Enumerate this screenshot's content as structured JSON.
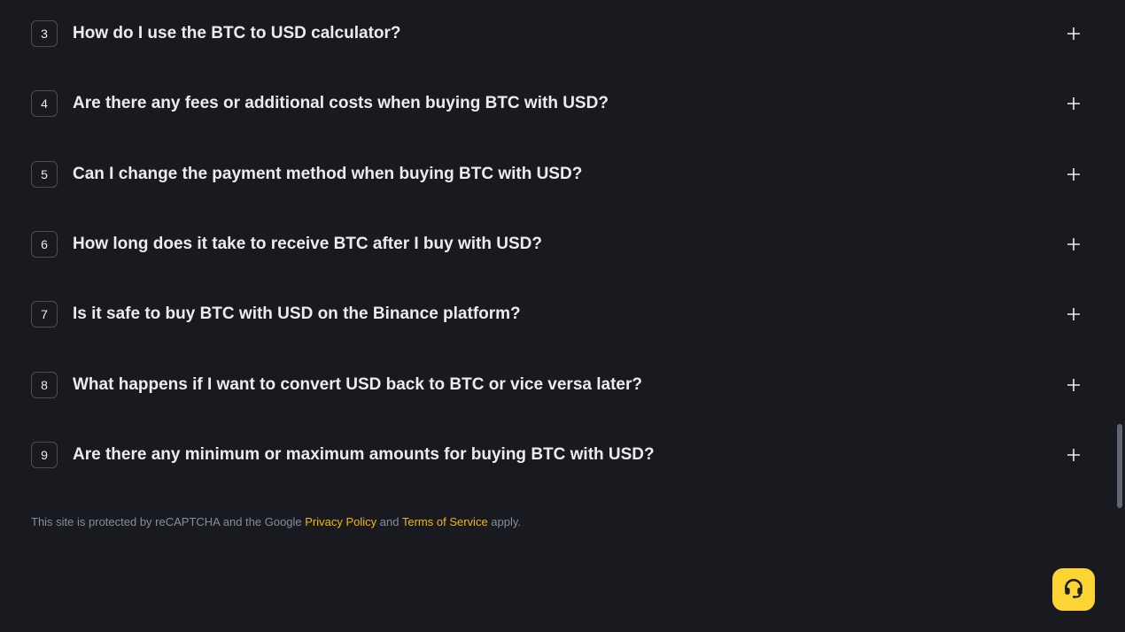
{
  "faq": {
    "items": [
      {
        "number": "3",
        "question": "How do I use the BTC to USD calculator?"
      },
      {
        "number": "4",
        "question": "Are there any fees or additional costs when buying BTC with USD?"
      },
      {
        "number": "5",
        "question": "Can I change the payment method when buying BTC with USD?"
      },
      {
        "number": "6",
        "question": "How long does it take to receive BTC after I buy with USD?"
      },
      {
        "number": "7",
        "question": "Is it safe to buy BTC with USD on the Binance platform?"
      },
      {
        "number": "8",
        "question": "What happens if I want to convert USD back to BTC or vice versa later?"
      },
      {
        "number": "9",
        "question": "Are there any minimum or maximum amounts for buying BTC with USD?"
      }
    ],
    "toggle_icon": "plus-icon"
  },
  "footer": {
    "recaptcha_prefix": "This site is protected by reCAPTCHA and the Google ",
    "privacy_link": "Privacy Policy",
    "and_text": " and ",
    "terms_link": "Terms of Service",
    "suffix": " apply."
  },
  "support": {
    "icon": "headset-icon"
  },
  "colors": {
    "background": "#181a20",
    "text": "#eaecef",
    "muted": "#848e9c",
    "accent": "#f0b90b",
    "support_button": "#fcd535"
  }
}
